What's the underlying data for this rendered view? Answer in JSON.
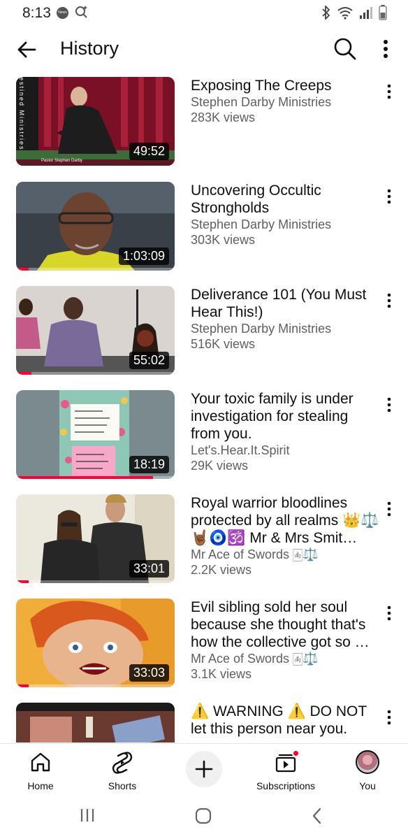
{
  "status_bar": {
    "time": "8:13",
    "news_badge": "News"
  },
  "header": {
    "title": "History"
  },
  "videos": [
    {
      "title": "Exposing The Creeps",
      "channel": "Stephen Darby Ministries",
      "views": "283K views",
      "duration": "49:52",
      "progress": 0.0,
      "thumb_caption": "Pastor Stephen Darby",
      "thumb_side_text": "estined Ministries"
    },
    {
      "title": "Uncovering Occultic Strongholds",
      "channel": "Stephen Darby Ministries",
      "views": "303K views",
      "duration": "1:03:09",
      "progress": 0.08
    },
    {
      "title": "Deliverance 101 (You Must Hear This!)",
      "channel": "Stephen Darby Ministries",
      "views": "516K views",
      "duration": "55:02",
      "progress": 0.1
    },
    {
      "title": "Your toxic family is under investigation for stealing from you.",
      "channel": "Let's.Hear.It.Spirit",
      "views": "29K views",
      "duration": "18:19",
      "progress": 0.86
    },
    {
      "title": "Royal warrior bloodlines protected by all realms 👑⚖️🤘🏾🧿🕉️ Mr & Mrs Smit…",
      "channel": "Mr Ace of Swords 🀁⚖️",
      "views": "2.2K views",
      "duration": "33:01",
      "progress": 0.08
    },
    {
      "title": "Evil sibling sold her soul because she thought that's how the collective got so …",
      "channel": "Mr Ace of Swords 🀁⚖️",
      "views": "3.1K views",
      "duration": "33:03",
      "progress": 0.08
    },
    {
      "title": "⚠️ WARNING ⚠️ DO NOT let this person near you.",
      "channel": "",
      "views": "",
      "duration": "",
      "progress": 0.0
    }
  ],
  "bottom_nav": [
    {
      "label": "Home",
      "icon": "home-icon"
    },
    {
      "label": "Shorts",
      "icon": "shorts-icon"
    },
    {
      "label": "",
      "icon": "create-plus-icon"
    },
    {
      "label": "Subscriptions",
      "icon": "subscriptions-icon"
    },
    {
      "label": "You",
      "icon": "avatar"
    }
  ],
  "colors": {
    "accent": "#ff0033",
    "text": "#0f0f0f",
    "secondary": "#606060"
  }
}
